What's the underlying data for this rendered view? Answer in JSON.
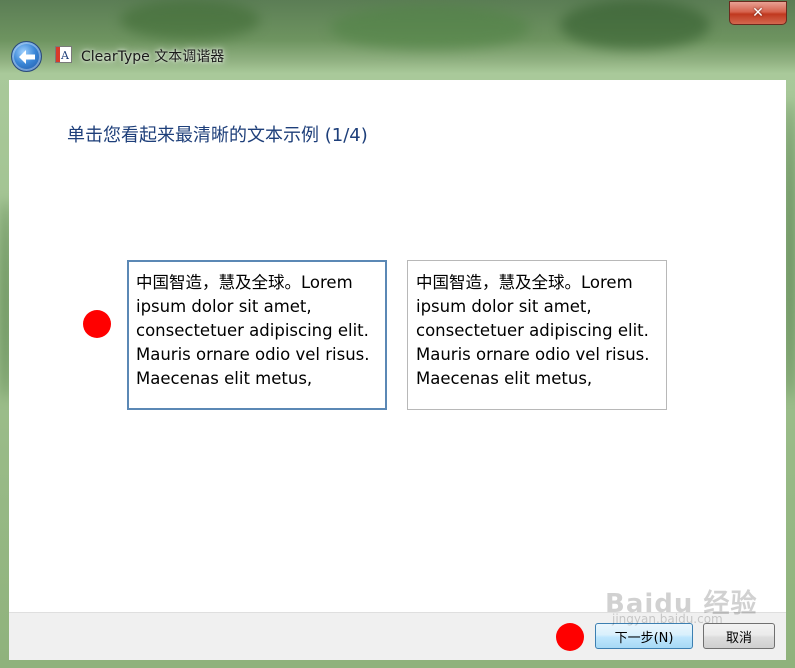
{
  "window": {
    "title": "ClearType 文本调谐器",
    "close_glyph": "✕"
  },
  "main": {
    "heading": "单击您看起来最清晰的文本示例 (1/4)",
    "samples": [
      {
        "lines": [
          "中国智造，慧及全球。Lorem",
          "ipsum dolor sit amet,",
          "consectetuer adipiscing elit.",
          "Mauris ornare odio vel risus.",
          "Maecenas elit metus,"
        ],
        "selected": true
      },
      {
        "lines": [
          "中国智造，慧及全球。Lorem",
          "ipsum dolor sit amet,",
          "consectetuer adipiscing elit.",
          "Mauris ornare odio vel risus.",
          "Maecenas elit metus,"
        ],
        "selected": false
      }
    ]
  },
  "footer": {
    "next_label": "下一步(N)",
    "cancel_label": "取消"
  },
  "watermark": {
    "text": "Baidu 经验",
    "sub": "jingyan.baidu.com"
  },
  "colors": {
    "heading": "#1e3f7a",
    "selected_border": "#5b88b5",
    "marker": "#ff0000"
  },
  "icons": {
    "back": "back-arrow-icon",
    "app": "cleartype-icon",
    "close": "close-icon"
  }
}
